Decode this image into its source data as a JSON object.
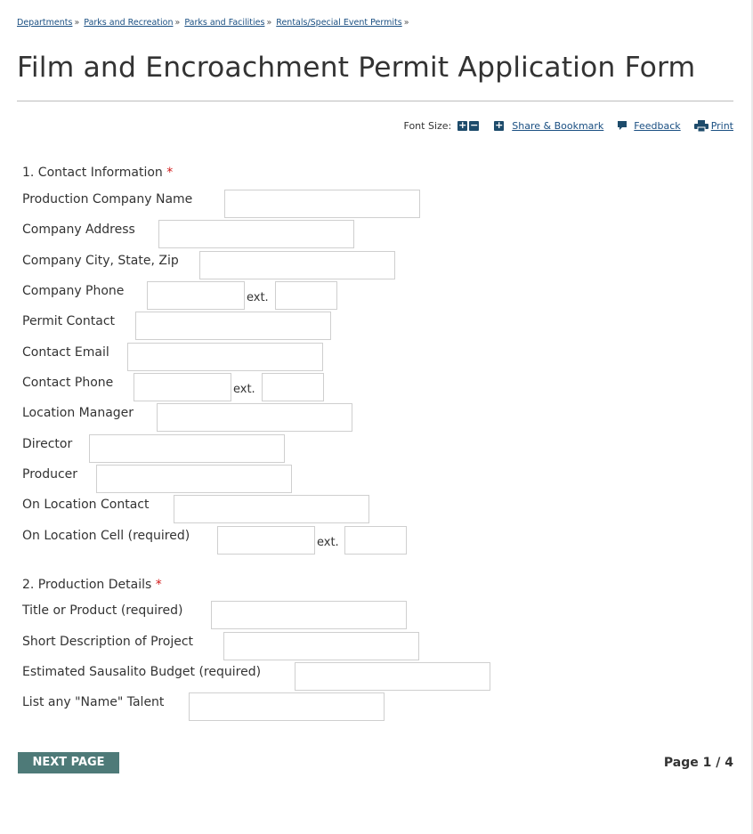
{
  "breadcrumb": {
    "items": [
      "Departments",
      "Parks and Recreation",
      "Parks and Facilities",
      "Rentals/Special Event Permits"
    ],
    "separator": "»"
  },
  "title": "Film and Encroachment Permit Application Form",
  "toolbar": {
    "font_size_label": "Font Size:",
    "plus": "+",
    "minus": "−",
    "share_label": "Share & Bookmark",
    "feedback_label": "Feedback",
    "print_label": "Print"
  },
  "sections": {
    "contact": {
      "title": "1. Contact Information",
      "required_mark": "*",
      "fields": {
        "production_company_name": "Production Company Name",
        "company_address": "Company Address",
        "company_city": "Company City, State, Zip",
        "company_phone": "Company Phone",
        "permit_contact": "Permit Contact",
        "contact_email": "Contact Email",
        "contact_phone": "Contact Phone",
        "location_manager": "Location Manager",
        "director": "Director",
        "producer": "Producer",
        "on_location_contact": "On Location Contact",
        "on_location_cell": "On Location Cell (required)"
      },
      "ext_label": "ext."
    },
    "production": {
      "title": "2. Production Details",
      "required_mark": "*",
      "fields": {
        "title_or_product": "Title or Product (required)",
        "short_description": "Short Description of Project",
        "budget": "Estimated Sausalito Budget (required)",
        "name_talent": "List any \"Name\" Talent"
      }
    }
  },
  "footer": {
    "next_label": "NEXT PAGE",
    "page_indicator": "Page 1 / 4"
  },
  "colors": {
    "link": "#1a4f82",
    "required": "#d11a1a",
    "button": "#4e7a78",
    "icon": "#1d4b6b"
  },
  "icons": {
    "share": "plus-square-icon",
    "feedback": "speech-bubble-icon",
    "print": "printer-icon"
  }
}
